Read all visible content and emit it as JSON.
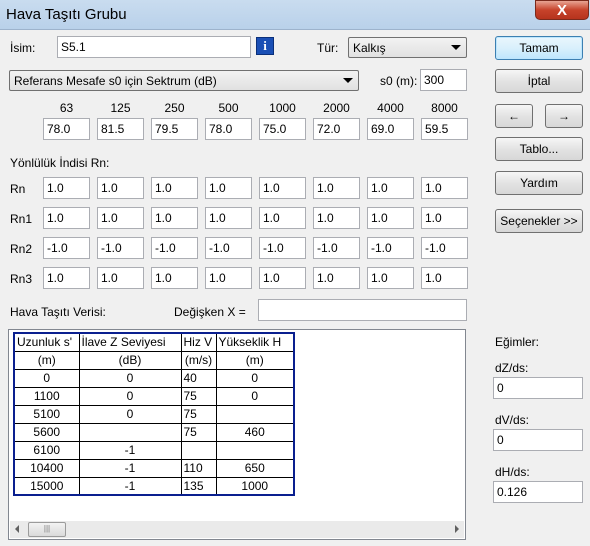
{
  "window": {
    "title": "Hava Taşıtı Grubu",
    "close_label": "X"
  },
  "name": {
    "label": "İsim:",
    "value": "S5.1"
  },
  "type": {
    "label": "Tür:",
    "value": "Kalkış"
  },
  "spectrum_select": {
    "value": "Referans Mesafe s0 için Sektrum (dB)"
  },
  "s0": {
    "label": "s0 (m):",
    "value": "300"
  },
  "frequencies": [
    "63",
    "125",
    "250",
    "500",
    "1000",
    "2000",
    "4000",
    "8000"
  ],
  "spectrum_values": [
    "78.0",
    "81.5",
    "79.5",
    "78.0",
    "75.0",
    "72.0",
    "69.0",
    "59.5"
  ],
  "directivity": {
    "heading": "Yönlülük İndisi Rn:",
    "rows": [
      {
        "label": "Rn",
        "values": [
          "1.0",
          "1.0",
          "1.0",
          "1.0",
          "1.0",
          "1.0",
          "1.0",
          "1.0"
        ]
      },
      {
        "label": "Rn1",
        "values": [
          "1.0",
          "1.0",
          "1.0",
          "1.0",
          "1.0",
          "1.0",
          "1.0",
          "1.0"
        ]
      },
      {
        "label": "Rn2",
        "values": [
          "-1.0",
          "-1.0",
          "-1.0",
          "-1.0",
          "-1.0",
          "-1.0",
          "-1.0",
          "-1.0"
        ]
      },
      {
        "label": "Rn3",
        "values": [
          "1.0",
          "1.0",
          "1.0",
          "1.0",
          "1.0",
          "1.0",
          "1.0",
          "1.0"
        ]
      }
    ]
  },
  "aircraft_data": {
    "label": "Hava Taşıtı Verisi:",
    "variable_label": "Değişken X =",
    "variable_value": ""
  },
  "table": {
    "headers": [
      "Uzunluk s'",
      "İlave Z Seviyesi",
      "Hiz V",
      "Yükseklik H"
    ],
    "units": [
      "(m)",
      "(dB)",
      "(m/s)",
      "(m)"
    ],
    "rows": [
      [
        "0",
        "0",
        "40",
        "0"
      ],
      [
        "1100",
        "0",
        "75",
        "0"
      ],
      [
        "5100",
        "0",
        "75",
        ""
      ],
      [
        "5600",
        "",
        "75",
        "460"
      ],
      [
        "6100",
        "-1",
        "",
        ""
      ],
      [
        "10400",
        "-1",
        "110",
        "650"
      ],
      [
        "15000",
        "-1",
        "135",
        "1000"
      ]
    ]
  },
  "scrollbar": {
    "thumb_glyph": "|||"
  },
  "buttons": {
    "ok": "Tamam",
    "cancel": "İptal",
    "prev": "←",
    "next": "→",
    "table": "Tablo...",
    "help": "Yardım",
    "options": "Seçenekler >>"
  },
  "slopes": {
    "heading": "Eğimler:",
    "dz_label": "dZ/ds:",
    "dz_value": "0",
    "dv_label": "dV/ds:",
    "dv_value": "0",
    "dh_label": "dH/ds:",
    "dh_value": "0.126"
  },
  "icons": {
    "info": "info-icon",
    "dropdown": "chevron-down-icon",
    "close": "close-icon"
  },
  "colors": {
    "table_border": "#0a1f8f",
    "info_icon": "#1a4fb5",
    "close_button": "#c7432b"
  }
}
